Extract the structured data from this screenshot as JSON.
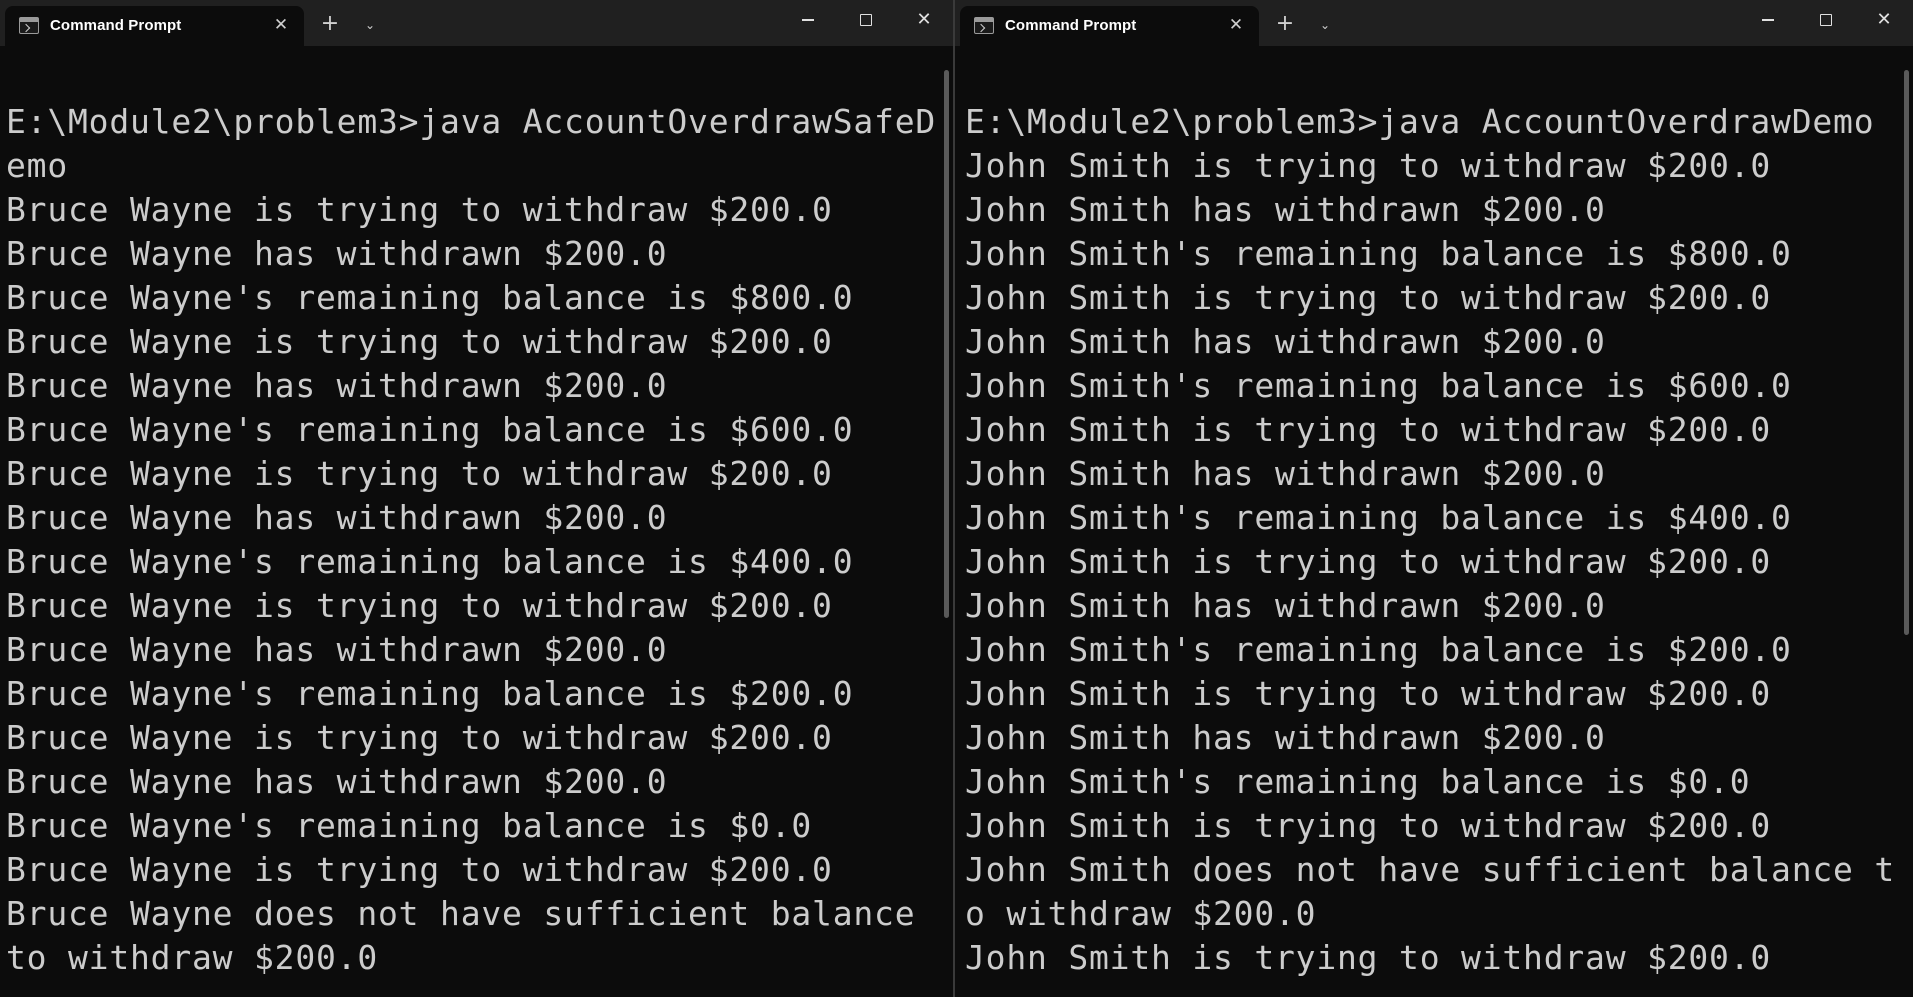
{
  "windows": [
    {
      "tab_title": "Command Prompt",
      "tab_icon": "terminal-icon",
      "lines": [
        "E:\\Module2\\problem3>java AccountOverdrawSafeD",
        "emo",
        "Bruce Wayne is trying to withdraw $200.0",
        "Bruce Wayne has withdrawn $200.0",
        "Bruce Wayne's remaining balance is $800.0",
        "Bruce Wayne is trying to withdraw $200.0",
        "Bruce Wayne has withdrawn $200.0",
        "Bruce Wayne's remaining balance is $600.0",
        "Bruce Wayne is trying to withdraw $200.0",
        "Bruce Wayne has withdrawn $200.0",
        "Bruce Wayne's remaining balance is $400.0",
        "Bruce Wayne is trying to withdraw $200.0",
        "Bruce Wayne has withdrawn $200.0",
        "Bruce Wayne's remaining balance is $200.0",
        "Bruce Wayne is trying to withdraw $200.0",
        "Bruce Wayne has withdrawn $200.0",
        "Bruce Wayne's remaining balance is $0.0",
        "Bruce Wayne is trying to withdraw $200.0",
        "Bruce Wayne does not have sufficient balance ",
        "to withdraw $200.0"
      ]
    },
    {
      "tab_title": "Command Prompt",
      "tab_icon": "terminal-icon",
      "lines": [
        "E:\\Module2\\problem3>java AccountOverdrawDemo",
        "John Smith is trying to withdraw $200.0",
        "John Smith has withdrawn $200.0",
        "John Smith's remaining balance is $800.0",
        "John Smith is trying to withdraw $200.0",
        "John Smith has withdrawn $200.0",
        "John Smith's remaining balance is $600.0",
        "John Smith is trying to withdraw $200.0",
        "John Smith has withdrawn $200.0",
        "John Smith's remaining balance is $400.0",
        "John Smith is trying to withdraw $200.0",
        "John Smith has withdrawn $200.0",
        "John Smith's remaining balance is $200.0",
        "John Smith is trying to withdraw $200.0",
        "John Smith has withdrawn $200.0",
        "John Smith's remaining balance is $0.0",
        "John Smith is trying to withdraw $200.0",
        "John Smith does not have sufficient balance t",
        "o withdraw $200.0",
        "John Smith is trying to withdraw $200.0"
      ]
    }
  ],
  "controls": {
    "new_tab": "+",
    "dropdown": "⌄",
    "tab_close": "✕",
    "close": "✕"
  },
  "colors": {
    "console_bg": "#0c0c0c",
    "titlebar_bg": "#202020",
    "console_text": "#cccccc"
  }
}
